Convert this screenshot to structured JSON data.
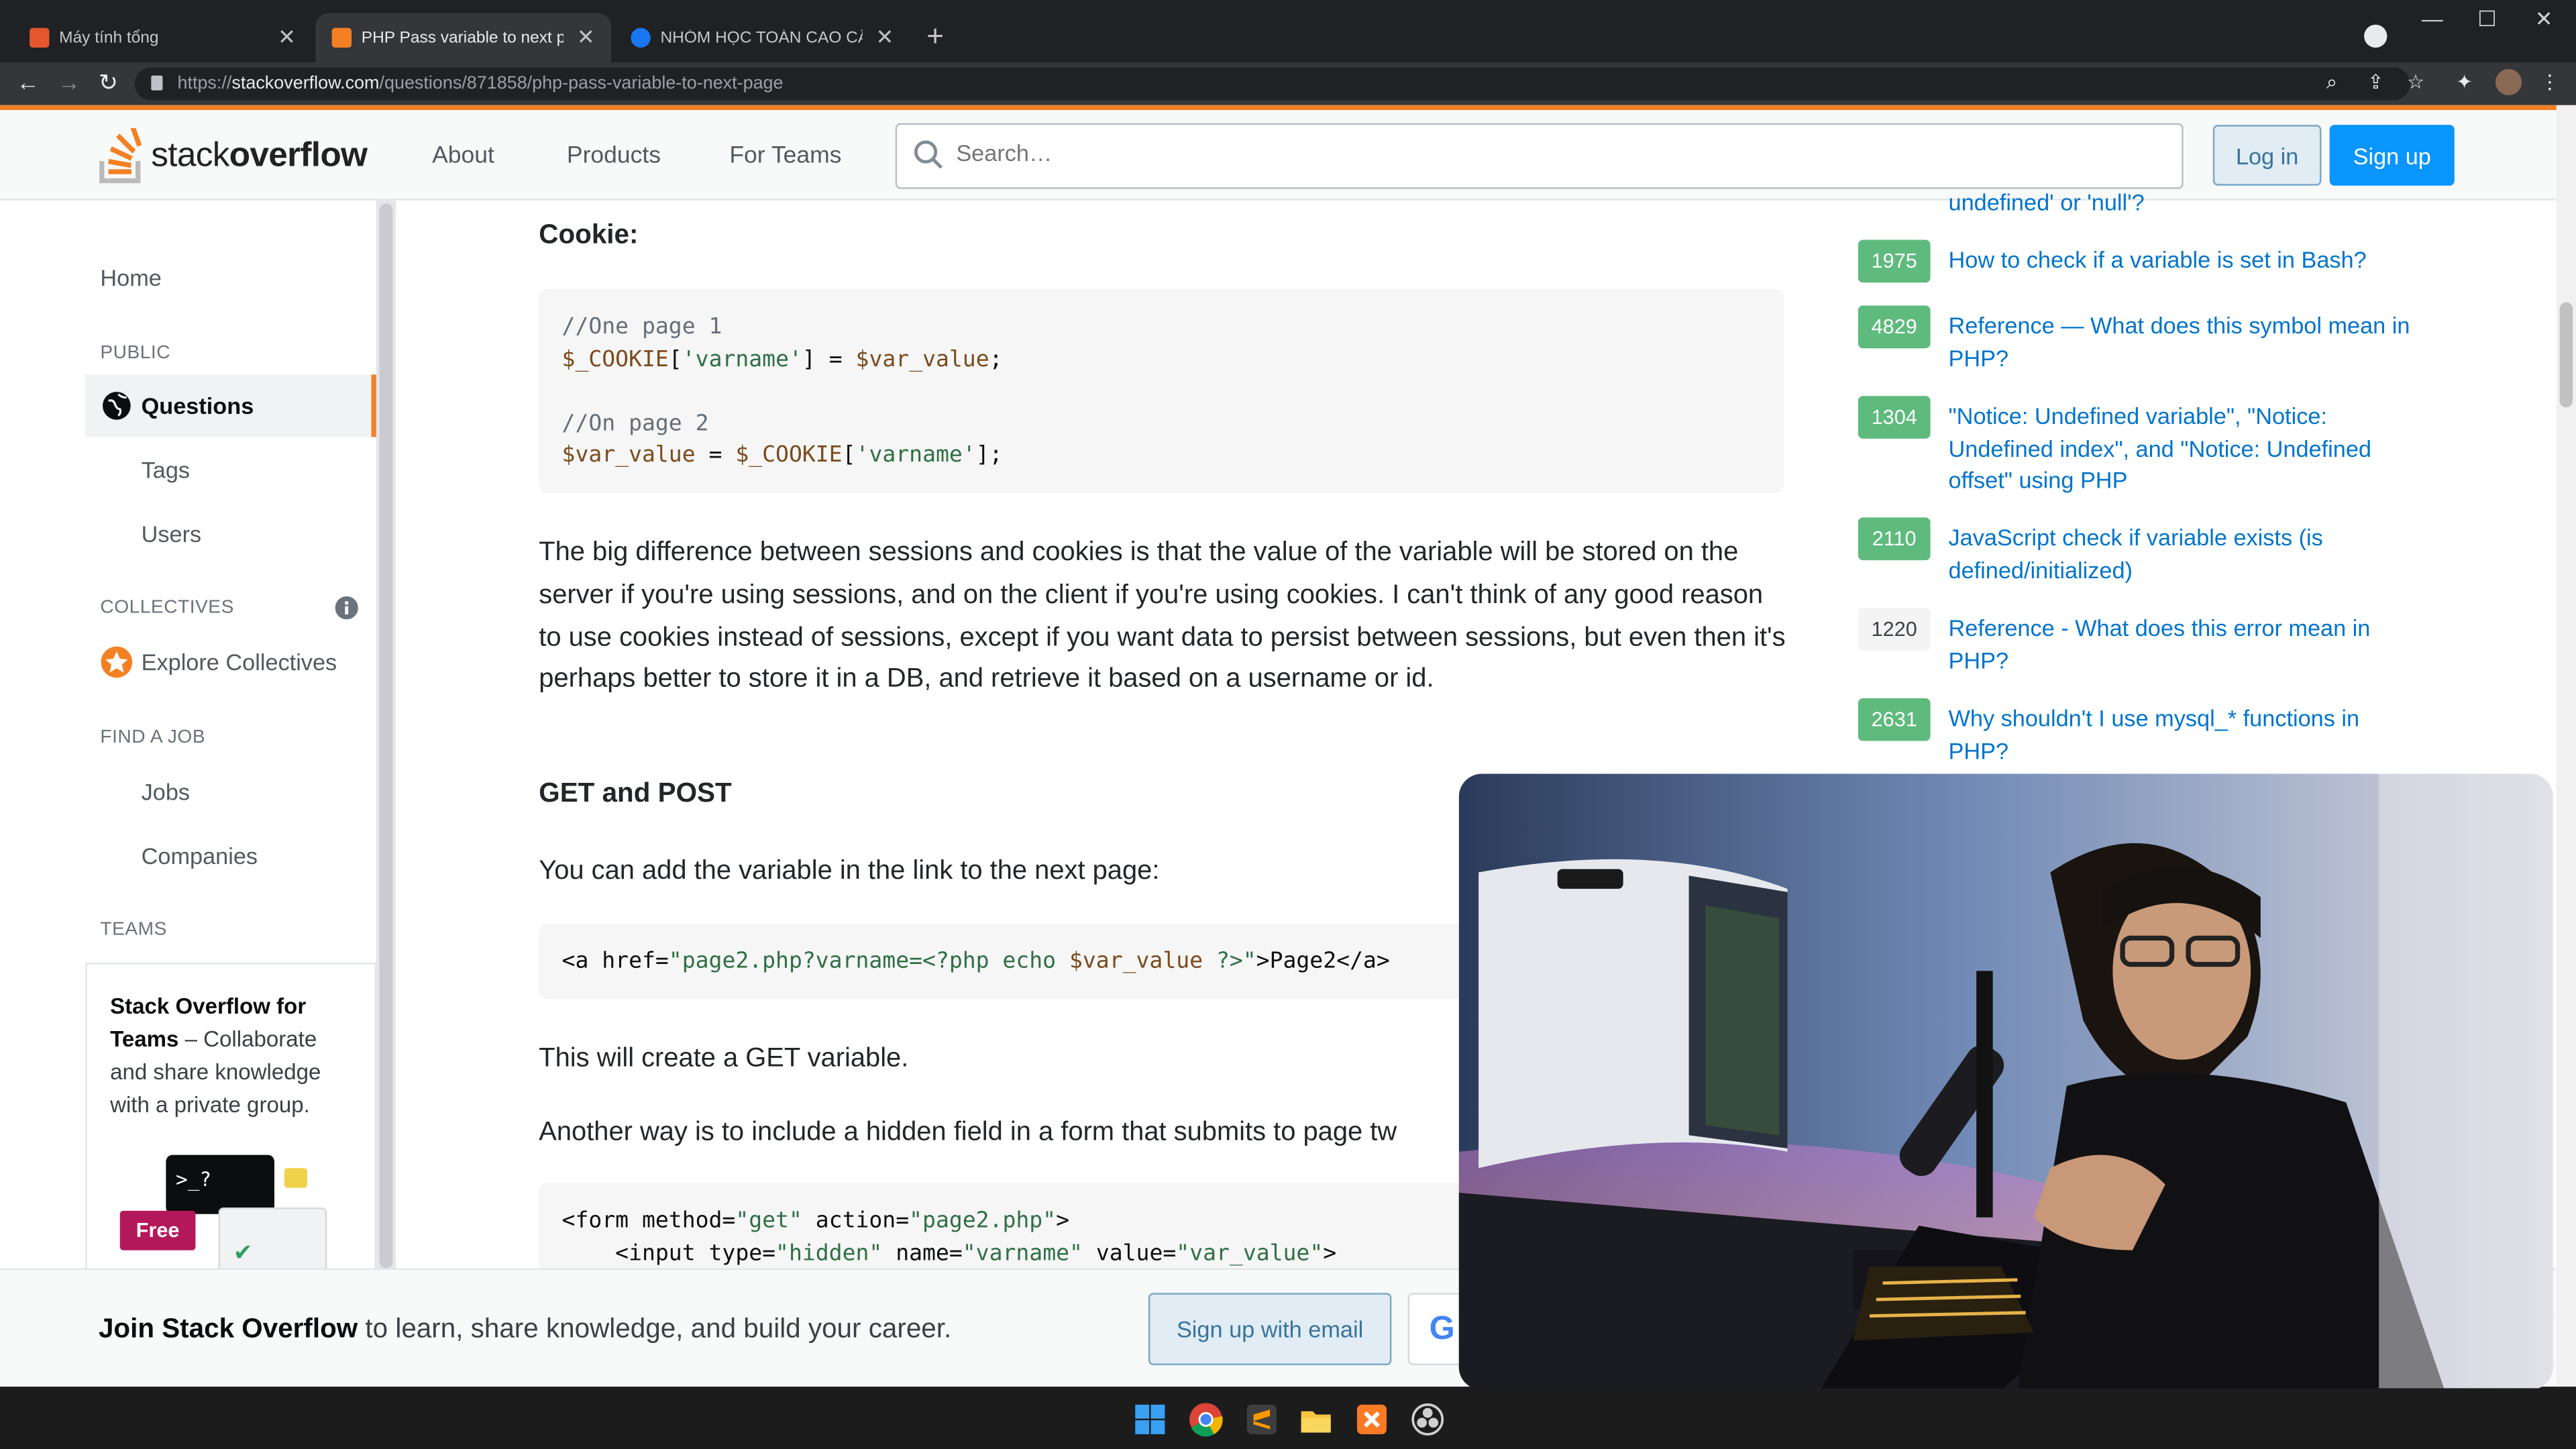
{
  "browser": {
    "tabs": [
      {
        "title": "Máy tính tổng",
        "active": false
      },
      {
        "title": "PHP Pass variable to next page -",
        "active": true
      },
      {
        "title": "NHÓM HỌC TOÁN CAO CẤP ĐẠI",
        "active": false
      }
    ],
    "url_prefix": "https://",
    "url_host": "stackoverflow.com",
    "url_path": "/questions/871858/php-pass-variable-to-next-page",
    "window_controls": {
      "minimize": "—",
      "maximize": "☐",
      "close": "✕"
    }
  },
  "header": {
    "logo_light": "stack",
    "logo_bold": "overflow",
    "nav": [
      "About",
      "Products",
      "For Teams"
    ],
    "search_placeholder": "Search…",
    "login_label": "Log in",
    "signup_label": "Sign up"
  },
  "sidebar": {
    "home": "Home",
    "public_heading": "PUBLIC",
    "questions": "Questions",
    "tags": "Tags",
    "users": "Users",
    "collectives_heading": "COLLECTIVES",
    "explore_collectives": "Explore Collectives",
    "find_job_heading": "FIND A JOB",
    "jobs": "Jobs",
    "companies": "Companies",
    "teams_heading": "TEAMS",
    "teams_promo_bold": "Stack Overflow for Teams",
    "teams_promo_rest": " – Collaborate and share knowledge with a private group.",
    "free_badge": "Free",
    "terminal_glyph": ">_?"
  },
  "answer": {
    "cookie_heading": "Cookie:",
    "cookie_code": {
      "comment1": "//One page 1",
      "line1_var": "$_COOKIE",
      "line1_rest_a": "[",
      "line1_str": "'varname'",
      "line1_rest_b": "] = ",
      "line1_var2": "$var_value",
      "line1_end": ";",
      "comment2": "//On page 2",
      "line2_var": "$var_value",
      "line2_mid": " = ",
      "line2_var2": "$_COOKIE",
      "line2_rest_a": "[",
      "line2_str": "'varname'",
      "line2_end": "];"
    },
    "sessions_para": "The big difference between sessions and cookies is that the value of the variable will be stored on the server if you're using sessions, and on the client if you're using cookies. I can't think of any good reason to use cookies instead of sessions, except if you want data to persist between sessions, but even then it's perhaps better to store it in a DB, and retrieve it based on a username or id.",
    "getpost_heading": "GET and POST",
    "link_para": "You can add the variable in the link to the next page:",
    "link_code": {
      "a": "<a href=",
      "str": "\"page2.php?varname=<?php echo ",
      "var": "$var_value",
      "str2": " ?>\"",
      "end": ">Page2</a>"
    },
    "get_para": "This will create a GET variable.",
    "hidden_para": "Another way is to include a hidden field in a form that submits to page tw",
    "form_code": {
      "l1a": "<form method=",
      "l1s1": "\"get\"",
      "l1b": " action=",
      "l1s2": "\"page2.php\"",
      "l1c": ">",
      "l2a": "    <input type=",
      "l2s1": "\"hidden\"",
      "l2b": " name=",
      "l2s2": "\"varname\"",
      "l2c": " value=",
      "l2s3": "\"var_value\"",
      "l2d": ">"
    }
  },
  "related": {
    "partial_top": "undefined' or 'null'?",
    "items": [
      {
        "score": "1975",
        "answered": true,
        "title": "How to check if a variable is set in Bash?"
      },
      {
        "score": "4829",
        "answered": true,
        "title": "Reference — What does this symbol mean in PHP?"
      },
      {
        "score": "1304",
        "answered": true,
        "title": "\"Notice: Undefined variable\", \"Notice: Undefined index\", and \"Notice: Undefined offset\" using PHP"
      },
      {
        "score": "2110",
        "answered": true,
        "title": "JavaScript check if variable exists (is defined/initialized)"
      },
      {
        "score": "1220",
        "answered": false,
        "title": "Reference - What does this error mean in PHP?"
      },
      {
        "score": "2631",
        "answered": true,
        "title": "Why shouldn't I use mysql_* functions in PHP?"
      }
    ]
  },
  "join_bar": {
    "bold": "Join Stack Overflow",
    "rest": " to learn, share knowledge, and build your career.",
    "email_button": "Sign up with email",
    "google_letter": "G"
  },
  "colors": {
    "so_orange": "#f48024",
    "so_blue": "#0a95ff",
    "answered_green": "#5eba7d",
    "link_blue": "#0074cc"
  }
}
